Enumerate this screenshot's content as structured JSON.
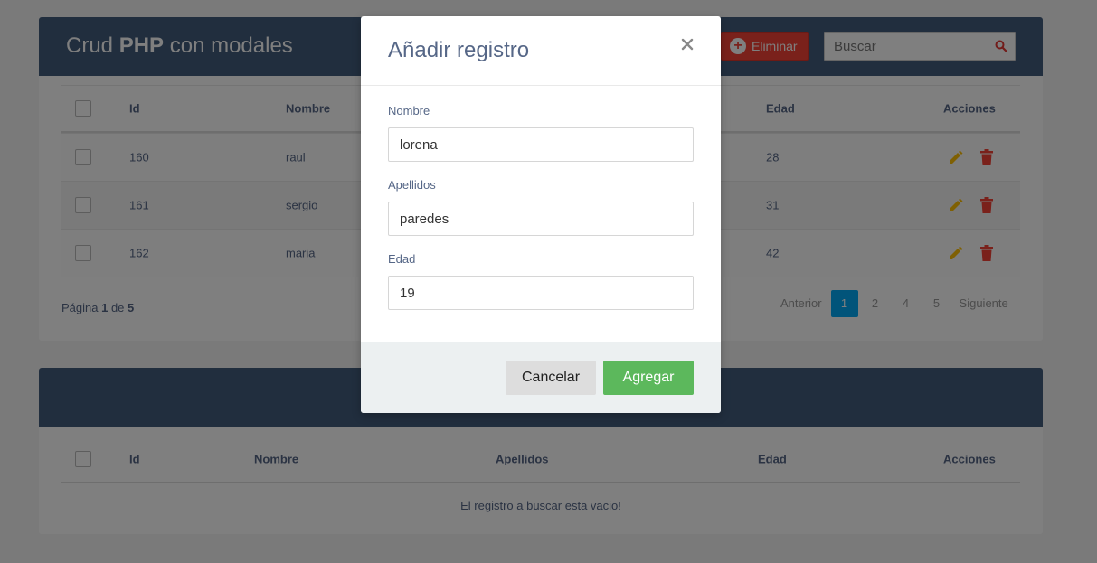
{
  "colors": {
    "header_bg": "#435d7d",
    "delete_bg": "#f44336",
    "pager_active": "#03A9F4",
    "edit_icon": "#FFC107",
    "delete_icon": "#F44336",
    "add_button": "#5cb85c",
    "overlay": "rgba(0,0,0,0.5)"
  },
  "top_panel": {
    "title_prefix": "Crud ",
    "title_bold": "PHP",
    "title_suffix": " con modales",
    "delete_button_label": "Eliminar",
    "search_placeholder": "Buscar",
    "columns": {
      "id": "Id",
      "nombre": "Nombre",
      "edad": "Edad",
      "acciones": "Acciones"
    },
    "rows": [
      {
        "id": "160",
        "nombre": "raul",
        "edad": "28"
      },
      {
        "id": "161",
        "nombre": "sergio",
        "edad": "31"
      },
      {
        "id": "162",
        "nombre": "maria",
        "edad": "42"
      }
    ],
    "page_info": {
      "label": "Página ",
      "current": "1",
      "of": " de ",
      "total": "5"
    },
    "pager": {
      "prev": "Anterior",
      "pages": [
        "1",
        "2",
        "4",
        "5"
      ],
      "active": "1",
      "next": "Siguiente"
    }
  },
  "bottom_panel": {
    "columns": {
      "id": "Id",
      "nombre": "Nombre",
      "apellidos": "Apellidos",
      "edad": "Edad",
      "acciones": "Acciones"
    },
    "empty_message": "El registro a buscar esta vacio!"
  },
  "modal": {
    "title": "Añadir registro",
    "fields": {
      "nombre_label": "Nombre",
      "nombre_value": "lorena",
      "apellidos_label": "Apellidos",
      "apellidos_value": "paredes",
      "edad_label": "Edad",
      "edad_value": "19"
    },
    "cancel_label": "Cancelar",
    "add_label": "Agregar"
  }
}
